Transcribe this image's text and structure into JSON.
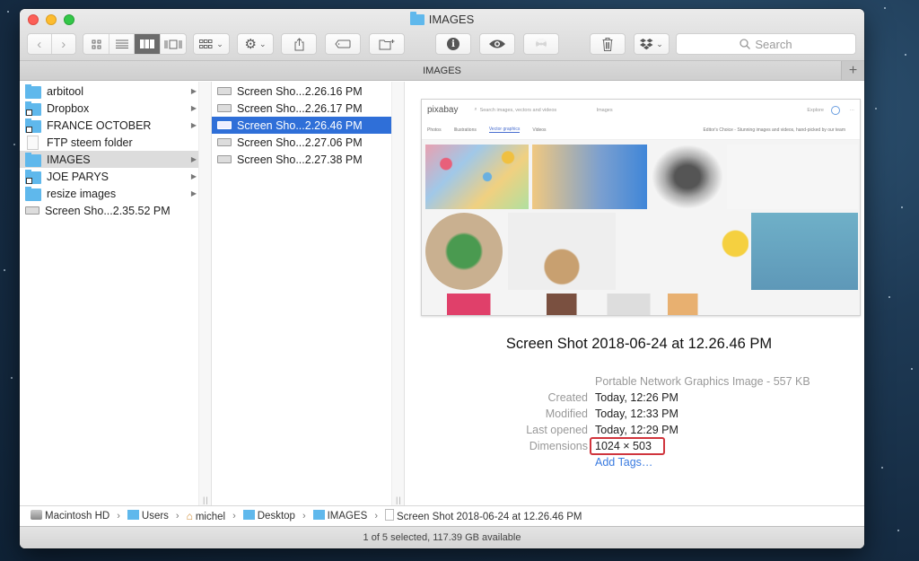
{
  "window": {
    "title": "IMAGES",
    "path_title": "IMAGES"
  },
  "toolbar": {
    "back_icon": "chevron-left-icon",
    "forward_icon": "chevron-right-icon",
    "view_modes": [
      "icon-view",
      "list-view",
      "column-view",
      "cover-flow-view"
    ],
    "active_view": "column-view",
    "arrange_icon": "arrange-grid-icon",
    "action_icon": "gear-icon",
    "share_icon": "share-icon",
    "tag_icon": "tag-icon",
    "new_folder_icon": "new-folder-icon",
    "info_icon": "info-icon",
    "quicklook_icon": "eye-icon",
    "burn_icon": "burn-icon",
    "trash_icon": "trash-icon",
    "dropbox_icon": "dropbox-icon",
    "search_placeholder": "Search"
  },
  "column1": {
    "items": [
      {
        "label": "arbitool",
        "type": "folder",
        "alias": false,
        "has_children": true
      },
      {
        "label": "Dropbox",
        "type": "folder",
        "alias": true,
        "has_children": true
      },
      {
        "label": "FRANCE OCTOBER",
        "type": "folder",
        "alias": true,
        "has_children": true
      },
      {
        "label": "FTP steem folder",
        "type": "document",
        "alias": false,
        "has_children": false
      },
      {
        "label": "IMAGES",
        "type": "folder",
        "alias": false,
        "has_children": true,
        "highlighted": true
      },
      {
        "label": "JOE PARYS",
        "type": "folder",
        "alias": true,
        "has_children": true
      },
      {
        "label": "resize images",
        "type": "folder",
        "alias": false,
        "has_children": true
      },
      {
        "label": "Screen Sho...2.35.52 PM",
        "type": "screenshot",
        "alias": false,
        "has_children": false
      }
    ]
  },
  "column2": {
    "items": [
      {
        "label": "Screen Sho...2.26.16 PM"
      },
      {
        "label": "Screen Sho...2.26.17 PM"
      },
      {
        "label": "Screen Sho...2.26.46 PM",
        "selected": true
      },
      {
        "label": "Screen Sho...2.27.06 PM"
      },
      {
        "label": "Screen Sho...2.27.38 PM"
      }
    ]
  },
  "preview": {
    "thumbnail": {
      "site_logo": "pixabay",
      "search_placeholder": "Search images, vectors and videos",
      "type_dropdown": "Images",
      "explore": "Explore",
      "tabs": [
        "Photos",
        "Illustrations",
        "Vector graphics",
        "Videos"
      ],
      "active_tab": "Vector graphics",
      "tagline": "Editor's Choice - Stunning images and videos, hand-picked by our team"
    },
    "file_name": "Screen Shot 2018-06-24 at 12.26.46 PM",
    "kind": "Portable Network Graphics Image - 557 KB",
    "fields": [
      {
        "key": "Created",
        "value": "Today, 12:26 PM"
      },
      {
        "key": "Modified",
        "value": "Today, 12:33 PM"
      },
      {
        "key": "Last opened",
        "value": "Today, 12:29 PM"
      },
      {
        "key": "Dimensions",
        "value": "1024 × 503"
      }
    ],
    "add_tags": "Add Tags…",
    "highlight_color": "#d0353d"
  },
  "breadcrumb": [
    {
      "label": "Macintosh HD",
      "icon": "hard-drive-icon"
    },
    {
      "label": "Users",
      "icon": "users-folder-icon"
    },
    {
      "label": "michel",
      "icon": "home-icon"
    },
    {
      "label": "Desktop",
      "icon": "desktop-folder-icon"
    },
    {
      "label": "IMAGES",
      "icon": "folder-icon"
    },
    {
      "label": "Screen Shot 2018-06-24 at 12.26.46 PM",
      "icon": "document-icon"
    }
  ],
  "status": {
    "text": "1 of 5 selected, 117.39 GB available"
  },
  "colors": {
    "selection": "#2f6fd8",
    "folder": "#5fb8ec",
    "link": "#3a7be0"
  }
}
